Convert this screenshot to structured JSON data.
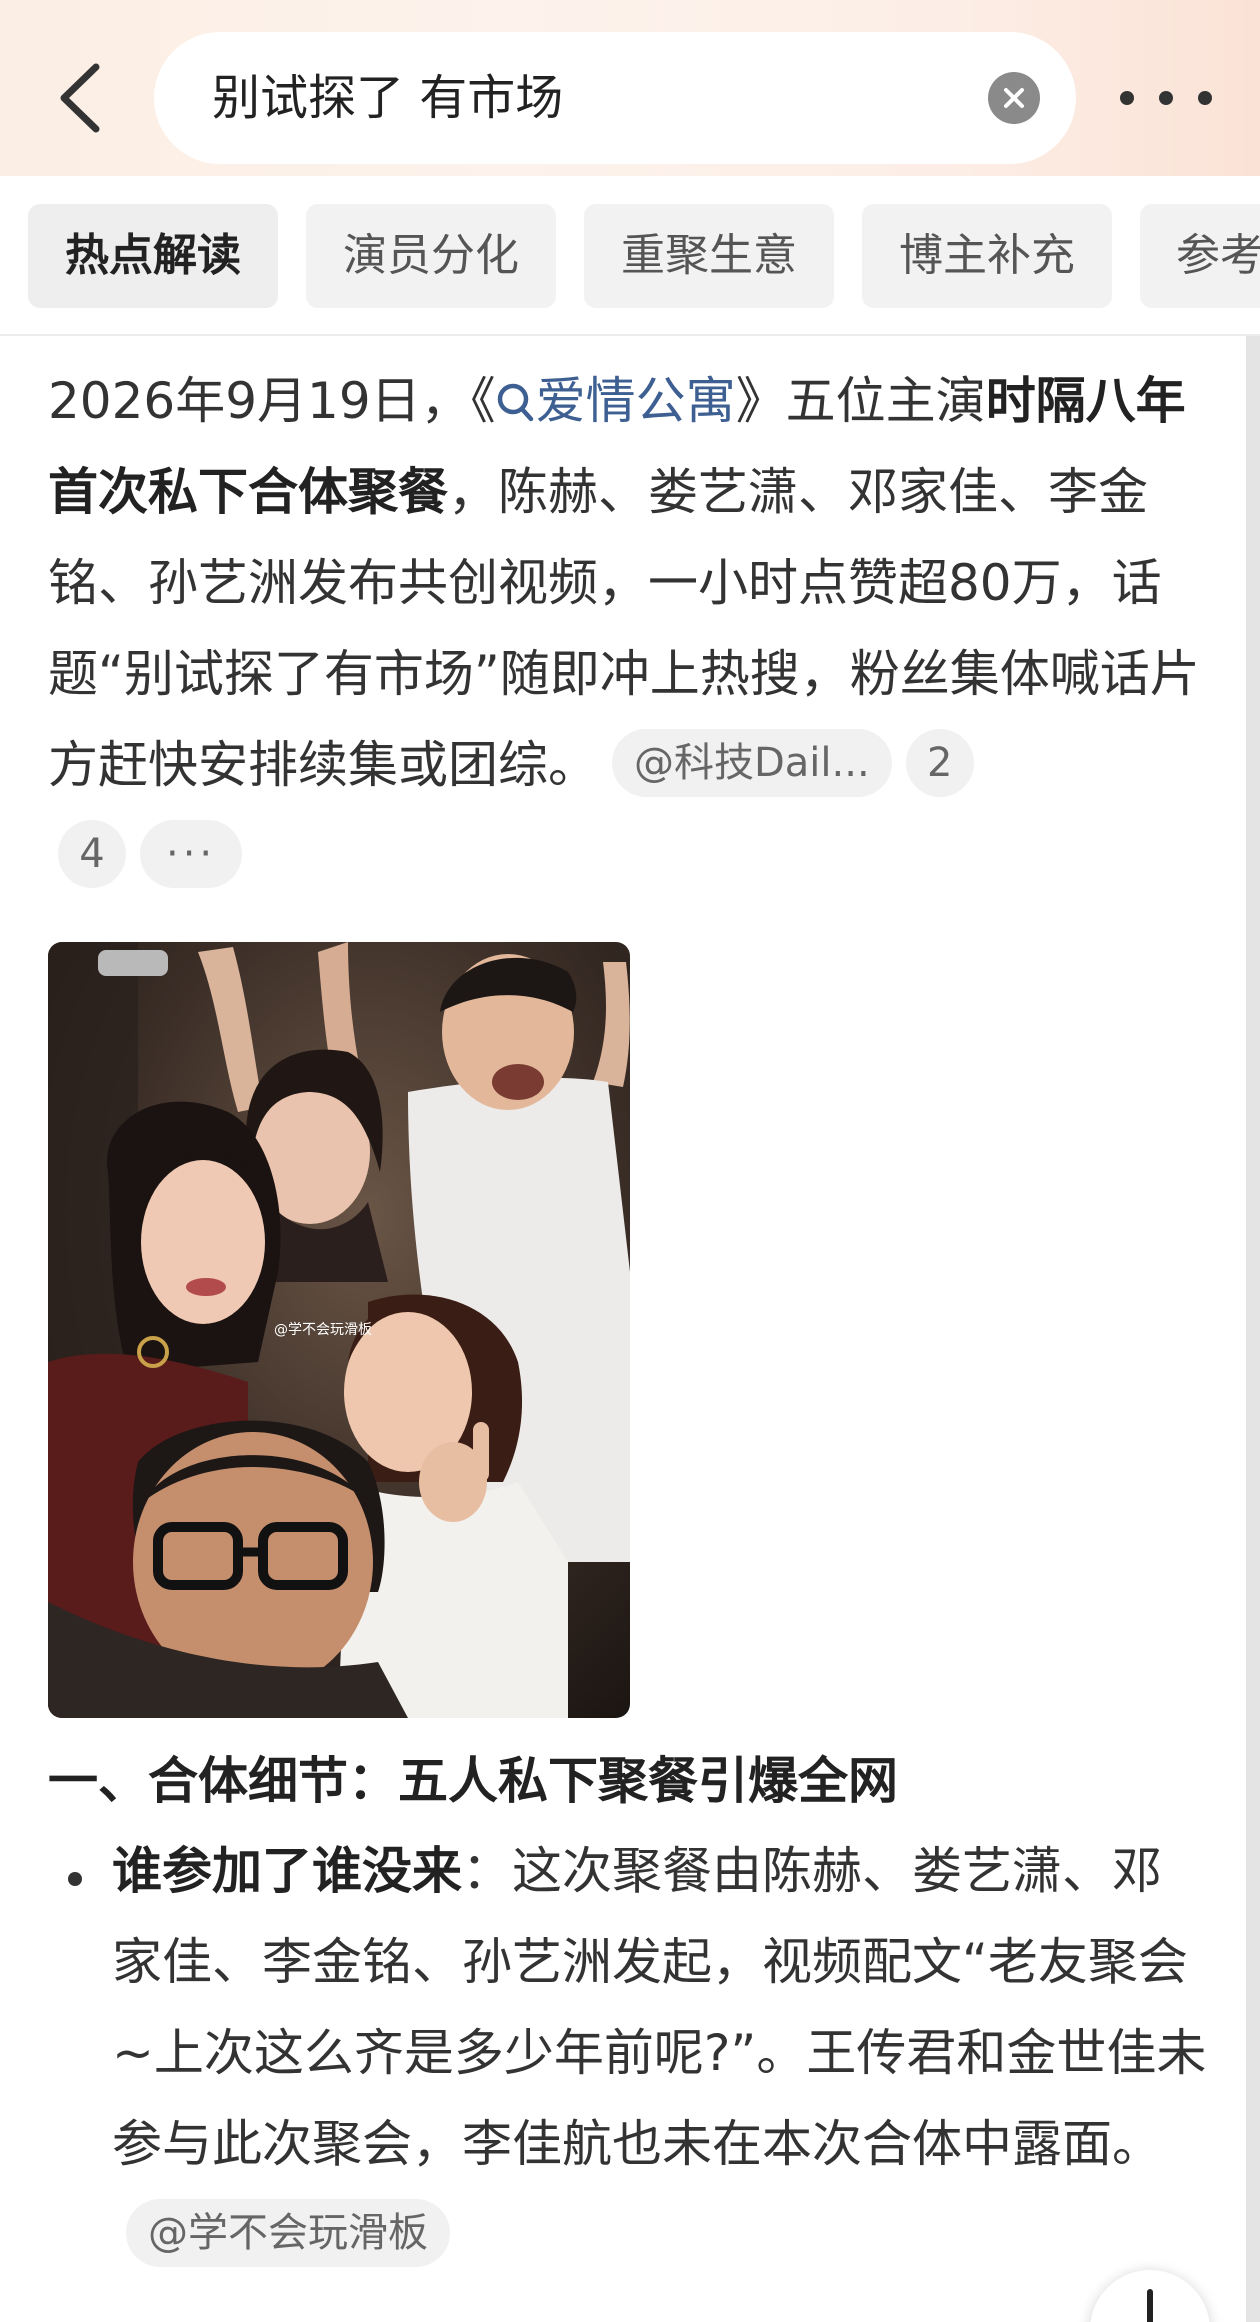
{
  "header": {
    "search_query": "别试探了 有市场"
  },
  "tabs": [
    {
      "label": "热点解读",
      "active": true
    },
    {
      "label": "演员分化",
      "active": false
    },
    {
      "label": "重聚生意",
      "active": false
    },
    {
      "label": "博主补充",
      "active": false
    },
    {
      "label": "参考",
      "active": false
    }
  ],
  "article": {
    "intro_prefix": "2026年9月19日，《",
    "entity_link": "爱情公寓",
    "intro_mid": "》五位主演",
    "intro_bold": "时隔八年首次私下合体聚餐",
    "intro_rest": "，陈赫、娄艺潇、邓家佳、李金铭、孙艺洲发布共创视频，一小时点赞超80万，话题“别试探了有市场”随即冲上热搜，粉丝集体喊话片方赶快安排续集或团综。",
    "source_pill": "@科技Dail...",
    "ref_2": "2",
    "ref_4": "4",
    "more_pill": "···",
    "photo_watermark": "@学不会玩滑板",
    "section1_heading": "一、合体细节：五人私下聚餐引爆全网",
    "bullet1_bold": "谁参加了谁没来",
    "bullet1_text": "：这次聚餐由陈赫、娄艺潇、邓家佳、李金铭、孙艺洲发起，视频配文“老友聚会~上次这么齐是多少年前呢?”。王传君和金世佳未参与此次聚会，李佳航也未在本次合体中露面。",
    "bullet1_source": "@学不会玩滑板"
  },
  "colors": {
    "link": "#3d5f91",
    "header_gradient_start": "#fbeee4",
    "header_gradient_end": "#fbe2d6"
  },
  "icons": {
    "back": "back-arrow-icon",
    "clear": "clear-icon",
    "more": "more-dots-icon",
    "search_entity": "search-icon"
  }
}
